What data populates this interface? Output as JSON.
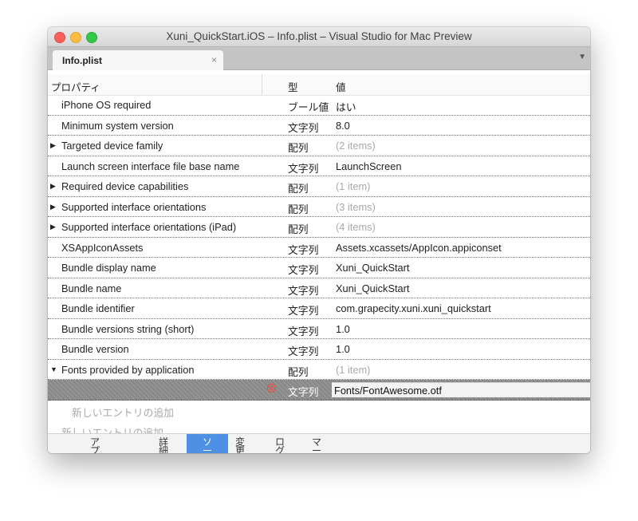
{
  "window": {
    "title": "Xuni_QuickStart.iOS – Info.plist – Visual Studio for Mac Preview"
  },
  "tabbar": {
    "tab_label": "Info.plist",
    "close_glyph": "×",
    "dropdown_glyph": "▼"
  },
  "columns": {
    "property": "プロパティ",
    "type": "型",
    "value": "値"
  },
  "rows": [
    {
      "key": "iPhone OS required",
      "type": "ブール値",
      "value": "はい",
      "expander": "",
      "muted": false
    },
    {
      "key": "Minimum system version",
      "type": "文字列",
      "value": "8.0",
      "expander": "",
      "muted": false
    },
    {
      "key": "Targeted device family",
      "type": "配列",
      "value": "(2 items)",
      "expander": "▶",
      "muted": true
    },
    {
      "key": "Launch screen interface file base name",
      "type": "文字列",
      "value": "LaunchScreen",
      "expander": "",
      "muted": false
    },
    {
      "key": "Required device capabilities",
      "type": "配列",
      "value": "(1 item)",
      "expander": "▶",
      "muted": true
    },
    {
      "key": "Supported interface orientations",
      "type": "配列",
      "value": "(3 items)",
      "expander": "▶",
      "muted": true
    },
    {
      "key": "Supported interface orientations (iPad)",
      "type": "配列",
      "value": "(4 items)",
      "expander": "▶",
      "muted": true
    },
    {
      "key": "XSAppIconAssets",
      "type": "文字列",
      "value": "Assets.xcassets/AppIcon.appiconset",
      "expander": "",
      "muted": false
    },
    {
      "key": "Bundle display name",
      "type": "文字列",
      "value": "Xuni_QuickStart",
      "expander": "",
      "muted": false
    },
    {
      "key": "Bundle name",
      "type": "文字列",
      "value": "Xuni_QuickStart",
      "expander": "",
      "muted": false
    },
    {
      "key": "Bundle identifier",
      "type": "文字列",
      "value": "com.grapecity.xuni.xuni_quickstart",
      "expander": "",
      "muted": false
    },
    {
      "key": "Bundle versions string (short)",
      "type": "文字列",
      "value": "1.0",
      "expander": "",
      "muted": false
    },
    {
      "key": "Bundle version",
      "type": "文字列",
      "value": "1.0",
      "expander": "",
      "muted": false
    },
    {
      "key": "Fonts provided by application",
      "type": "配列",
      "value": "(1 item)",
      "expander": "▼",
      "muted": true
    }
  ],
  "selected_row": {
    "type": "文字列",
    "value": "Fonts/FontAwesome.otf",
    "icon": "remove-circle-icon"
  },
  "add_entries": [
    "新しいエントリの追加",
    "新しいエントリの追加"
  ],
  "bottom_tabs": [
    {
      "label": "アプ",
      "active": false
    },
    {
      "label": "詳細",
      "active": false
    },
    {
      "label": "ソー",
      "active": true
    },
    {
      "label": "変更",
      "active": false
    },
    {
      "label": "ログ",
      "active": false
    },
    {
      "label": "マー",
      "active": false
    }
  ],
  "colors": {
    "active_tab": "#4d90e4",
    "remove_icon": "#f04a3e",
    "selected_row": "#8d8d8d"
  }
}
